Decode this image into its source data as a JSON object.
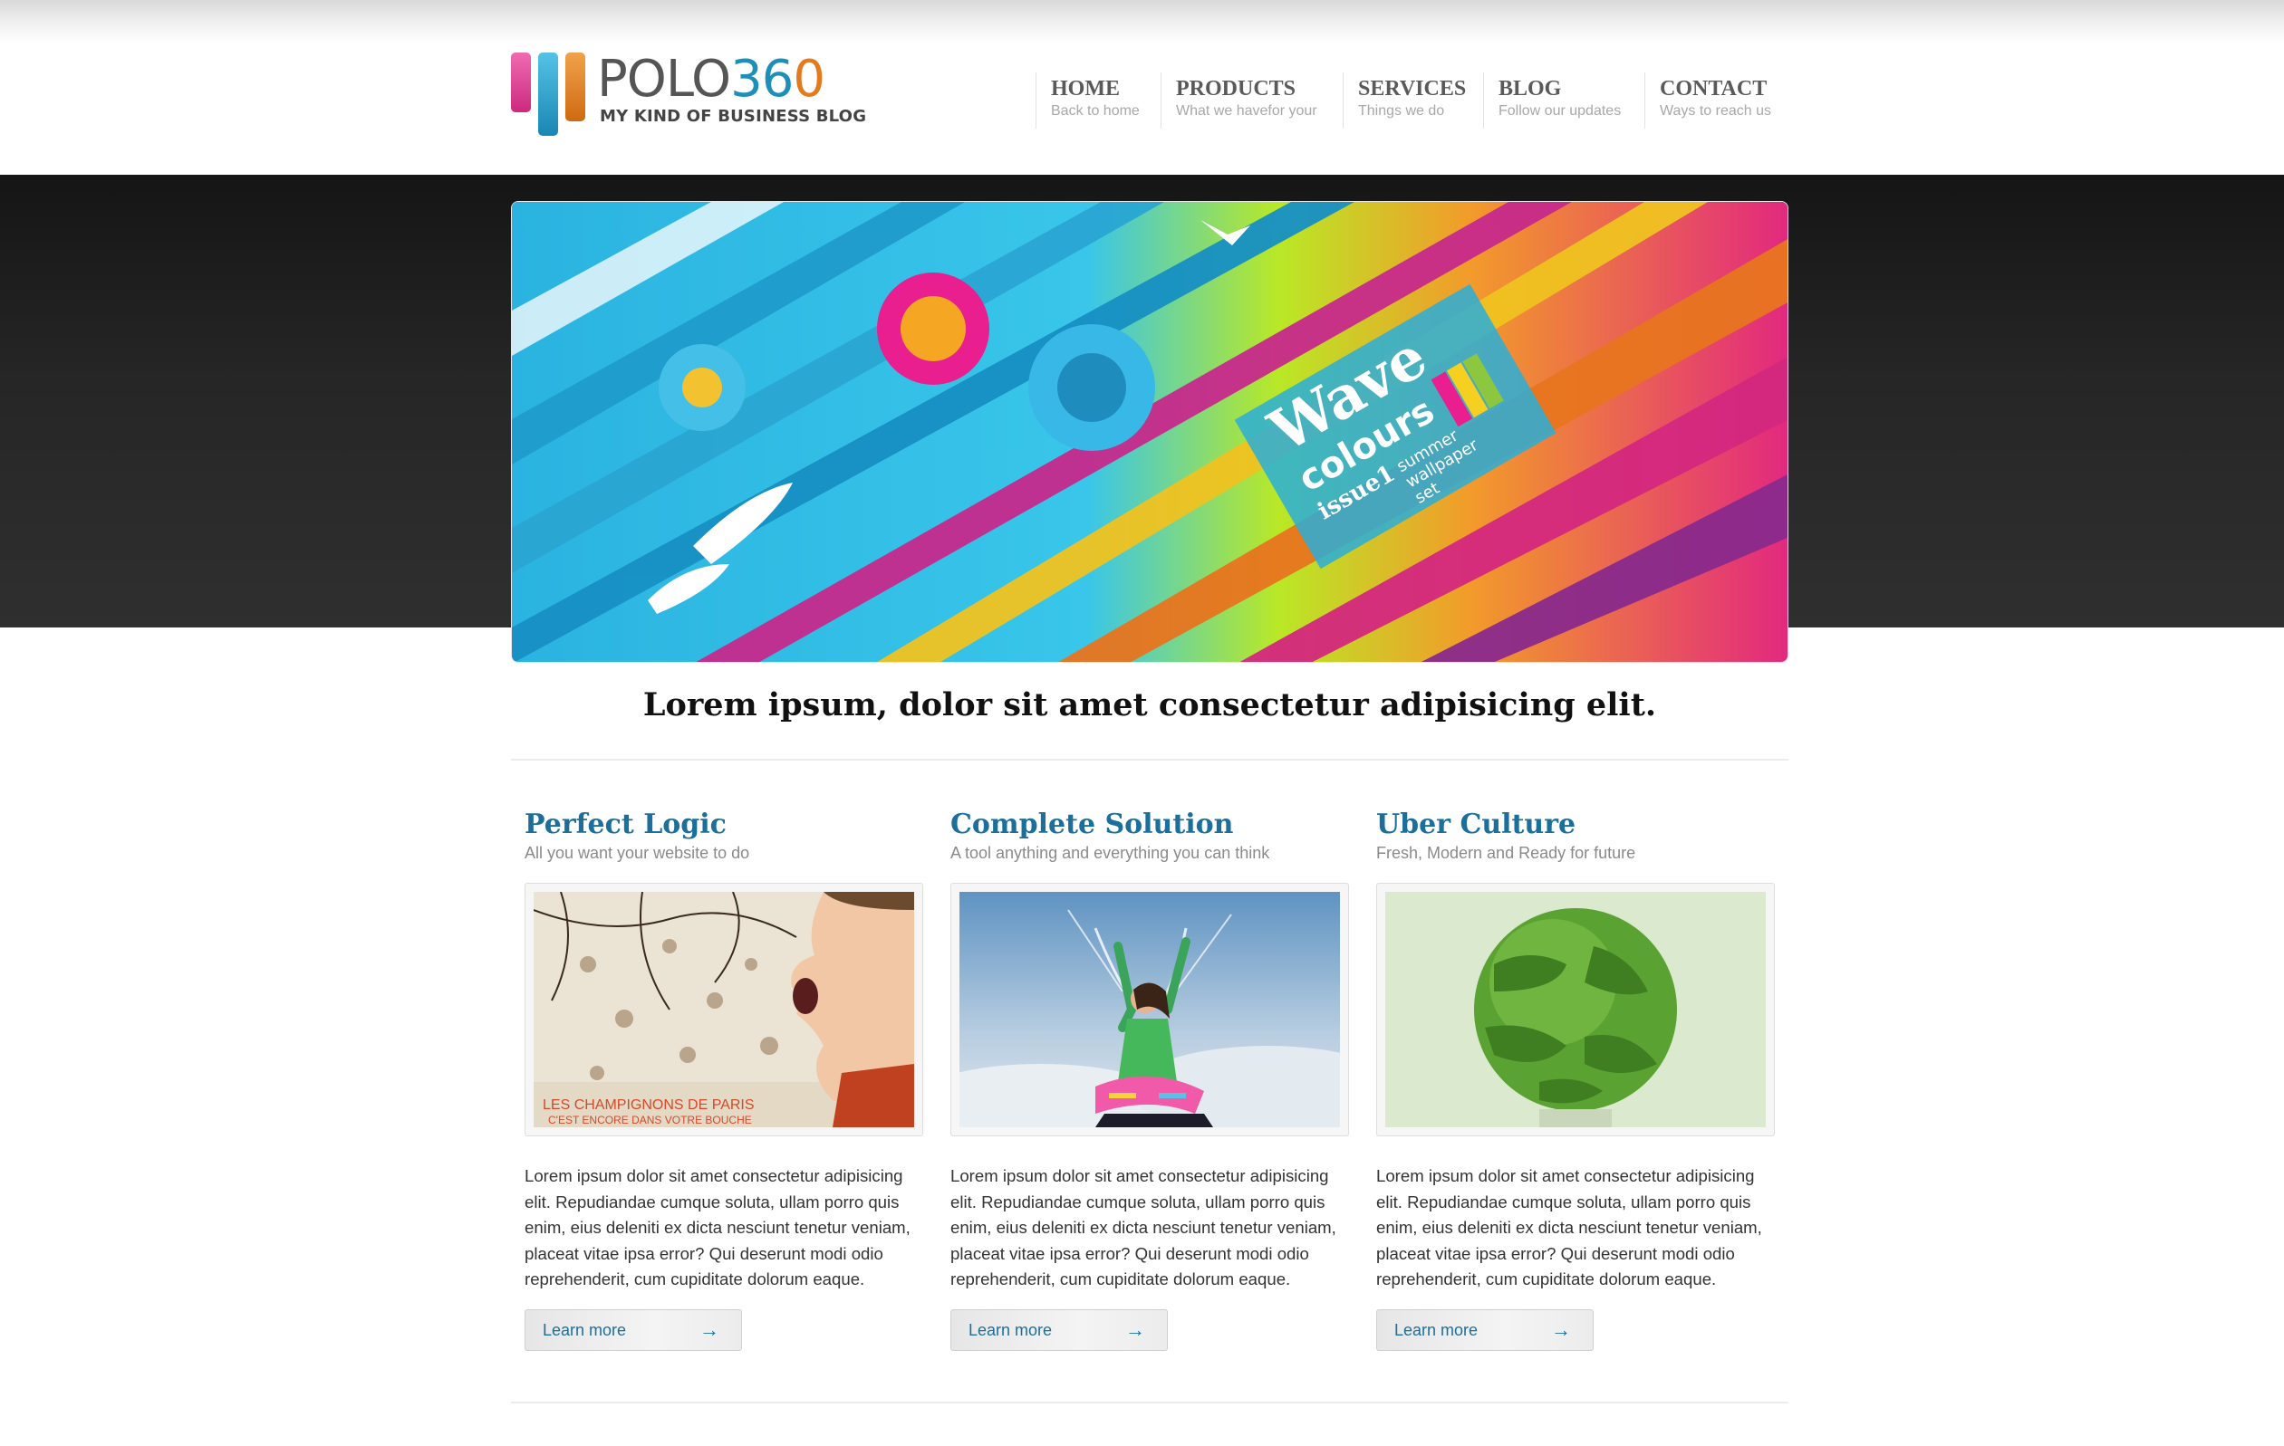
{
  "logo": {
    "name_prefix": "POLO",
    "name_digits": "36",
    "name_zero": "0",
    "tagline": "MY KIND OF BUSINESS BLOG"
  },
  "nav": [
    {
      "label": "HOME",
      "sub": "Back to home"
    },
    {
      "label": "PRODUCTS",
      "sub": "What we havefor your"
    },
    {
      "label": "SERVICES",
      "sub": "Things we do"
    },
    {
      "label": "BLOG",
      "sub": "Follow our updates"
    },
    {
      "label": "CONTACT",
      "sub": "Ways to reach us"
    }
  ],
  "hero": {
    "line1": "Wave",
    "line2": "colours",
    "line3": "issue1",
    "line4": "summer",
    "line5": "wallpaper",
    "line6": "set"
  },
  "tagline": "Lorem ipsum, dolor sit amet consectetur adipisicing elit.",
  "features": [
    {
      "title": "Perfect Logic",
      "subtitle": "All you want your website to do",
      "image_caption_1": "LES CHAMPIGNONS DE PARIS",
      "image_caption_2": "C'EST ENCORE DANS VOTRE BOUCHE",
      "body": "Lorem ipsum dolor sit amet consectetur adipisicing elit. Repudiandae cumque soluta, ullam porro quis enim, eius deleniti ex dicta nesciunt tenetur veniam, placeat vitae ipsa error? Qui deserunt modi odio reprehenderit, cum cupiditate dolorum eaque.",
      "button": "Learn more",
      "arrow": "→"
    },
    {
      "title": "Complete Solution",
      "subtitle": "A tool anything and everything you can think",
      "body": "Lorem ipsum dolor sit amet consectetur adipisicing elit. Repudiandae cumque soluta, ullam porro quis enim, eius deleniti ex dicta nesciunt tenetur veniam, placeat vitae ipsa error? Qui deserunt modi odio reprehenderit, cum cupiditate dolorum eaque.",
      "button": "Learn more",
      "arrow": "→"
    },
    {
      "title": "Uber Culture",
      "subtitle": "Fresh, Modern and Ready for future",
      "body": "Lorem ipsum dolor sit amet consectetur adipisicing elit. Repudiandae cumque soluta, ullam porro quis enim, eius deleniti ex dicta nesciunt tenetur veniam, placeat vitae ipsa error? Qui deserunt modi odio reprehenderit, cum cupiditate dolorum eaque.",
      "button": "Learn more",
      "arrow": "→"
    }
  ],
  "colors": {
    "accent": "#1c6f9b",
    "dark_band": "#2a2a2a",
    "logo_pink": "#d8307f",
    "logo_blue": "#1d8fb9",
    "logo_orange": "#e37a1d"
  }
}
